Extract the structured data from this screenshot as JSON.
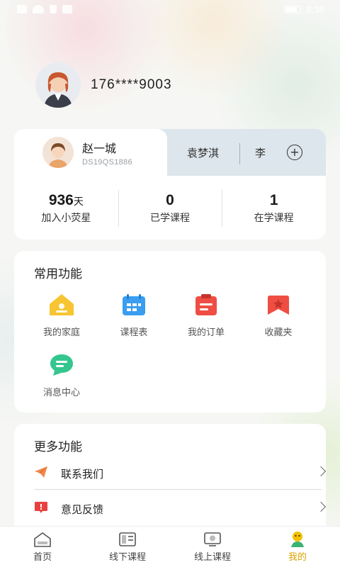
{
  "status_bar": {
    "time": "8:38"
  },
  "profile": {
    "phone": "176****9003"
  },
  "students": {
    "active": {
      "name": "赵一城",
      "id": "DS19QS1886"
    },
    "others": [
      "袁梦淇",
      "李"
    ]
  },
  "stats": [
    {
      "value": "936",
      "unit": "天",
      "label": "加入小荧星"
    },
    {
      "value": "0",
      "unit": "",
      "label": "已学课程"
    },
    {
      "value": "1",
      "unit": "",
      "label": "在学课程"
    }
  ],
  "common_functions": {
    "title": "常用功能",
    "items": [
      {
        "label": "我的家庭",
        "icon": "home-icon",
        "color": "#f7c531"
      },
      {
        "label": "课程表",
        "icon": "calendar-icon",
        "color": "#3a9df0"
      },
      {
        "label": "我的订单",
        "icon": "order-icon",
        "color": "#ee4e43"
      },
      {
        "label": "收藏夹",
        "icon": "favorite-icon",
        "color": "#ee4e43"
      },
      {
        "label": "消息中心",
        "icon": "message-icon",
        "color": "#35c68f"
      }
    ]
  },
  "more_functions": {
    "title": "更多功能",
    "items": [
      {
        "label": "联系我们",
        "icon": "paper-plane-icon",
        "color": "#f08a4b"
      },
      {
        "label": "意见反馈",
        "icon": "feedback-icon",
        "color": "#e8403f"
      }
    ]
  },
  "tabbar": {
    "items": [
      {
        "label": "首页",
        "icon": "home-tab-icon"
      },
      {
        "label": "线下课程",
        "icon": "offline-course-icon"
      },
      {
        "label": "线上课程",
        "icon": "online-course-icon"
      },
      {
        "label": "我的",
        "icon": "me-icon"
      }
    ],
    "active_index": 3,
    "active_color": "#d9a400"
  }
}
